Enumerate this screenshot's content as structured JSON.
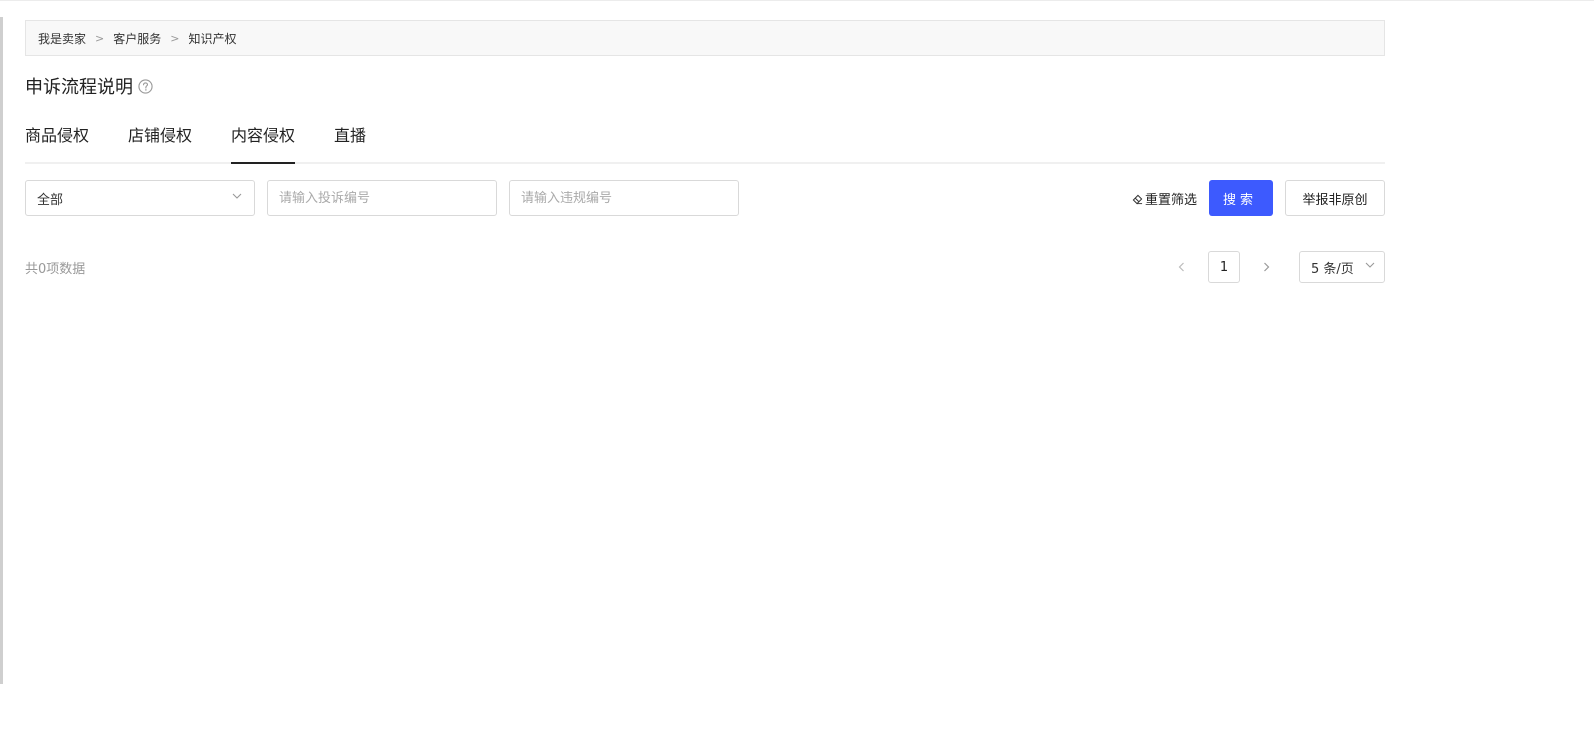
{
  "breadcrumb": {
    "items": [
      "我是卖家",
      "客户服务",
      "知识产权"
    ],
    "separator": ">"
  },
  "page": {
    "title": "申诉流程说明",
    "help_icon": "question-circle-icon"
  },
  "tabs": [
    {
      "label": "商品侵权",
      "active": false
    },
    {
      "label": "店铺侵权",
      "active": false
    },
    {
      "label": "内容侵权",
      "active": true
    },
    {
      "label": "直播",
      "active": false
    }
  ],
  "filters": {
    "status_select": {
      "value": "全部"
    },
    "complaint_no": {
      "placeholder": "请输入投诉编号",
      "value": ""
    },
    "violation_no": {
      "placeholder": "请输入违规编号",
      "value": ""
    },
    "reset_label": "重置筛选",
    "search_label": "搜索",
    "report_label": "举报非原创"
  },
  "results": {
    "total_text": "共0项数据"
  },
  "pagination": {
    "current_page": "1",
    "page_size_label": "5 条/页"
  },
  "colors": {
    "primary": "#3d5afe",
    "border": "#d9d9d9",
    "breadcrumb_bg": "#f8f8f8"
  }
}
